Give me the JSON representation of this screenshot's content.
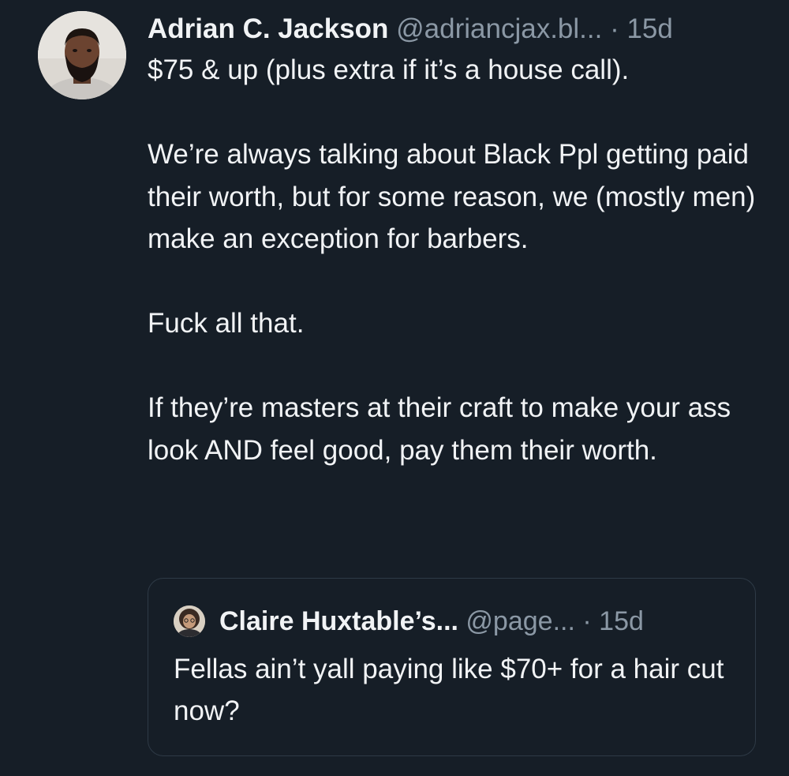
{
  "post": {
    "author": {
      "display_name": "Adrian C. Jackson",
      "handle": "@adriancjax.bl...",
      "separator": "·",
      "time": "15d",
      "avatar_icon": "user-avatar-photo"
    },
    "paragraphs": [
      "$75 & up (plus extra if it’s a house call).",
      "We’re always talking about Black Ppl getting paid their worth, but for some reason, we (mostly men) make an exception for barbers.",
      "Fuck all that.",
      "If they’re masters at their craft to make your ass look AND feel good, pay them their worth."
    ]
  },
  "quoted_post": {
    "author": {
      "display_name": "Claire Huxtable’s...",
      "handle": "@page...",
      "separator": "·",
      "time": "15d",
      "avatar_icon": "user-avatar-photo"
    },
    "text": "Fellas ain’t yall paying like $70+ for a hair cut now?"
  },
  "colors": {
    "background": "#161e27",
    "primary_text": "#f1f3f5",
    "secondary_text": "#8b98a5",
    "border": "#2e3a46"
  }
}
